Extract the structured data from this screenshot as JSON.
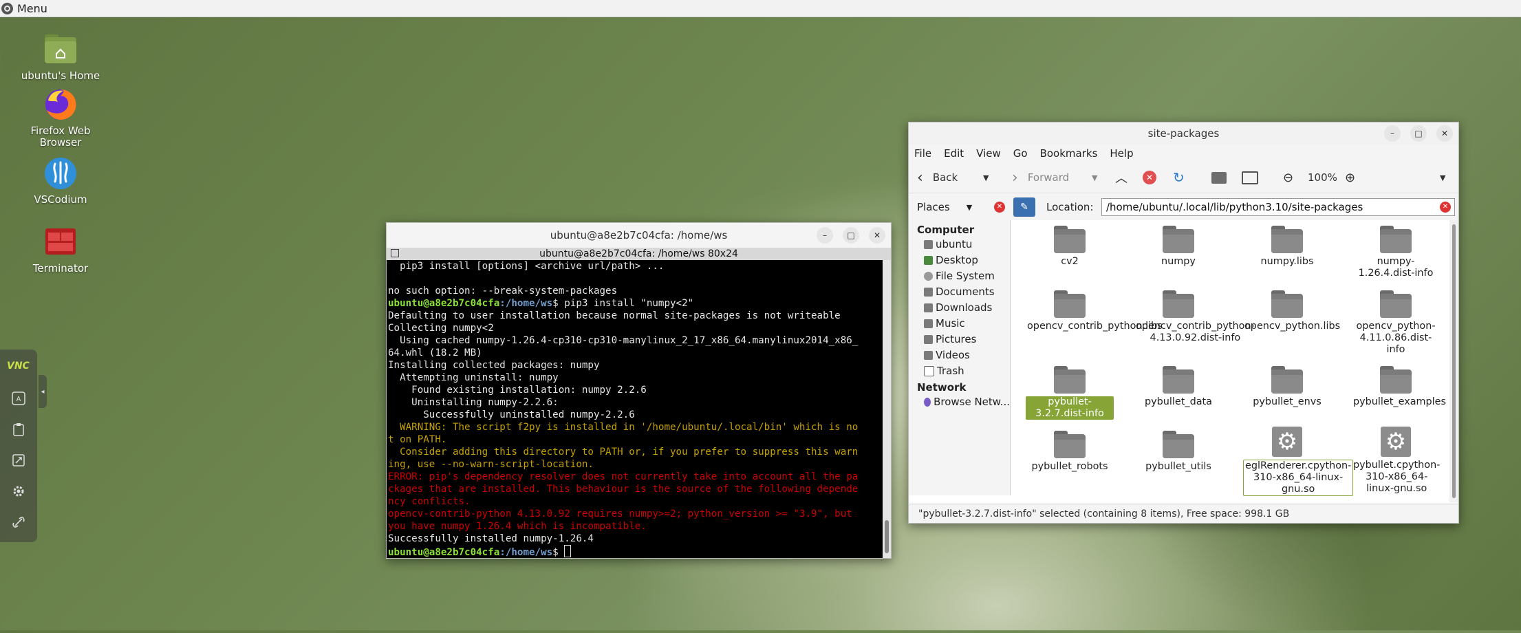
{
  "top_panel": {
    "menu_label": "Menu"
  },
  "desktop": {
    "icons": [
      {
        "label": "ubuntu's Home",
        "icon": "home-folder-icon"
      },
      {
        "label": "Firefox Web Browser",
        "icon": "firefox-icon"
      },
      {
        "label": "VSCodium",
        "icon": "vscodium-icon"
      },
      {
        "label": "Terminator",
        "icon": "terminator-icon"
      }
    ]
  },
  "vnc_panel": {
    "logo": "VNC"
  },
  "terminal": {
    "title": "ubuntu@a8e2b7c04cfa: /home/ws",
    "tab_title": "ubuntu@a8e2b7c04cfa: /home/ws 80x24",
    "prompt_user": "ubuntu@a8e2b7c04cfa",
    "prompt_path": ":/home/ws",
    "lines": [
      "  pip3 install [options] <archive url/path> ...",
      "",
      "no such option: --break-system-packages",
      "$ pip3 install \"numpy<2\"",
      "Defaulting to user installation because normal site-packages is not writeable",
      "Collecting numpy<2",
      "  Using cached numpy-1.26.4-cp310-cp310-manylinux_2_17_x86_64.manylinux2014_x86_",
      "64.whl (18.2 MB)",
      "Installing collected packages: numpy",
      "  Attempting uninstall: numpy",
      "    Found existing installation: numpy 2.2.6",
      "    Uninstalling numpy-2.2.6:",
      "      Successfully uninstalled numpy-2.2.6",
      "  WARNING: The script f2py is installed in '/home/ubuntu/.local/bin' which is no",
      "t on PATH.",
      "  Consider adding this directory to PATH or, if you prefer to suppress this warn",
      "ing, use --no-warn-script-location.",
      "ERROR: pip's dependency resolver does not currently take into account all the pa",
      "ckages that are installed. This behaviour is the source of the following depende",
      "ncy conflicts.",
      "opencv-contrib-python 4.13.0.92 requires numpy>=2; python_version >= \"3.9\", but",
      "you have numpy 1.26.4 which is incompatible.",
      "Successfully installed numpy-1.26.4",
      "$ "
    ]
  },
  "file_manager": {
    "title": "site-packages",
    "menu": [
      "File",
      "Edit",
      "View",
      "Go",
      "Bookmarks",
      "Help"
    ],
    "toolbar": {
      "back": "Back",
      "forward": "Forward",
      "zoom": "100%"
    },
    "places_label": "Places",
    "location_label": "Location:",
    "location_value": "/home/ubuntu/.local/lib/python3.10/site-packages",
    "sidebar": {
      "computer_heading": "Computer",
      "computer_items": [
        "ubuntu",
        "Desktop",
        "File System",
        "Documents",
        "Downloads",
        "Music",
        "Pictures",
        "Videos",
        "Trash"
      ],
      "network_heading": "Network",
      "network_items": [
        "Browse Netw..."
      ]
    },
    "items": [
      {
        "name": "cv2",
        "type": "folder"
      },
      {
        "name": "numpy",
        "type": "folder"
      },
      {
        "name": "numpy.libs",
        "type": "folder"
      },
      {
        "name": "numpy-1.26.4.dist-info",
        "type": "folder"
      },
      {
        "name": "opencv_contrib_python.libs",
        "type": "folder"
      },
      {
        "name": "opencv_contrib_python-4.13.0.92.dist-info",
        "type": "folder"
      },
      {
        "name": "opencv_python.libs",
        "type": "folder"
      },
      {
        "name": "opencv_python-4.11.0.86.dist-info",
        "type": "folder"
      },
      {
        "name": "pybullet-3.2.7.dist-info",
        "type": "folder"
      },
      {
        "name": "pybullet_data",
        "type": "folder"
      },
      {
        "name": "pybullet_envs",
        "type": "folder"
      },
      {
        "name": "pybullet_examples",
        "type": "folder"
      },
      {
        "name": "pybullet_robots",
        "type": "folder"
      },
      {
        "name": "pybullet_utils",
        "type": "folder"
      },
      {
        "name": "eglRenderer.cpython-310-x86_64-linux-gnu.so",
        "type": "library"
      },
      {
        "name": "pybullet.cpython-310-x86_64-linux-gnu.so",
        "type": "library"
      }
    ],
    "status": "\"pybullet-3.2.7.dist-info\" selected (containing 8 items), Free space: 998.1 GB"
  }
}
